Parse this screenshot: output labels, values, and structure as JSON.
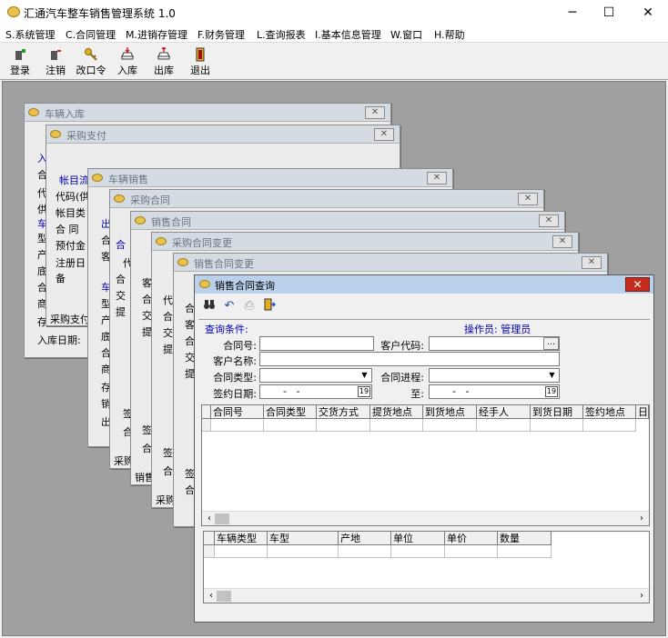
{
  "app": {
    "title": "汇通汽车整车销售管理系统 1.0",
    "minimize": "─",
    "maximize": "☐",
    "close": "✕"
  },
  "menu": [
    "S.系统管理",
    "C.合同管理",
    "M.进销存管理",
    "F.财务管理",
    "L.查询报表",
    "I.基本信息管理",
    "W.窗口",
    "H.帮助"
  ],
  "toolbar": [
    {
      "label": "登录",
      "icon": "login-icon"
    },
    {
      "label": "注销",
      "icon": "logout-icon"
    },
    {
      "label": "改口令",
      "icon": "key-icon"
    },
    {
      "label": "入库",
      "icon": "car-in-icon"
    },
    {
      "label": "出库",
      "icon": "car-out-icon"
    },
    {
      "label": "退出",
      "icon": "exit-icon"
    }
  ],
  "windows": {
    "w1": {
      "title": "车辆入库",
      "frag": [
        "入",
        "合",
        "代",
        "供",
        "车",
        "型",
        "产",
        "底",
        "合",
        "商",
        "存",
        "入库日期:"
      ]
    },
    "w2": {
      "title": "采购支付",
      "frag": [
        "帐目流",
        "代码(供",
        "帐目类",
        "合 同",
        "预付金",
        "注册日",
        "备",
        "采购支付"
      ]
    },
    "w3": {
      "title": "车辆销售",
      "frag": [
        "出",
        "合",
        "客",
        "车",
        "型",
        "产",
        "底",
        "合",
        "商",
        "存",
        "销",
        "出"
      ]
    },
    "w4": {
      "title": "采购合同",
      "frag": [
        "合",
        "代",
        "合",
        "交",
        "提",
        "签",
        "合",
        "采购"
      ]
    },
    "w5": {
      "title": "销售合同",
      "frag": [
        "客",
        "合",
        "交",
        "提",
        "签",
        "合",
        "销售"
      ]
    },
    "w6": {
      "title": "采购合同变更",
      "frag": [
        "代",
        "合",
        "交",
        "提",
        "签",
        "合",
        "采购"
      ]
    },
    "w7": {
      "title": "销售合同变更",
      "frag": [
        "合",
        "客",
        "合",
        "交",
        "提",
        "签",
        "合"
      ]
    }
  },
  "query": {
    "title": "销售合同查询",
    "close": "✕",
    "section": "查询条件:",
    "operator": "操作员: 管理员",
    "labels": {
      "contract_no": "合同号:",
      "cust_code": "客户代码:",
      "cust_name": "客户名称:",
      "contract_type": "合同类型:",
      "contract_progress": "合同进程:",
      "sign_date": "签约日期:",
      "to": "至:"
    },
    "values": {
      "contract_no": "",
      "cust_code": "",
      "cust_name": "",
      "contract_type": "",
      "contract_progress": "",
      "date_from": "  -   -",
      "date_to": "  -   -"
    },
    "ellipsis": "…",
    "cal_icon": "19",
    "grid1": [
      "合同号",
      "合同类型",
      "交货方式",
      "提货地点",
      "到货地点",
      "经手人",
      "到货日期",
      "签约地点",
      "日"
    ],
    "grid2": [
      "车辆类型",
      "车型",
      "产地",
      "单位",
      "单价",
      "数量"
    ]
  }
}
